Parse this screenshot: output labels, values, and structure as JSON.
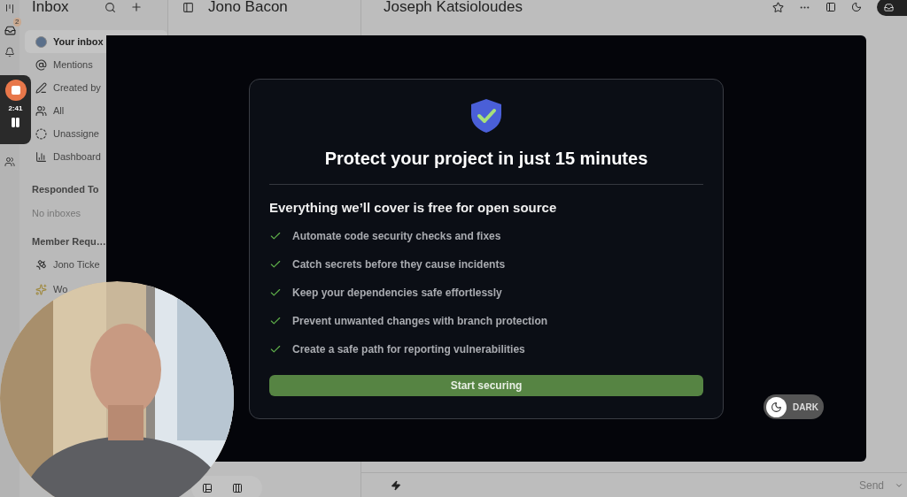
{
  "rail": {
    "badge": "2"
  },
  "recorder": {
    "time": "2:41"
  },
  "sidebar": {
    "title": "Inbox",
    "items": [
      {
        "kind": "avatar",
        "label": "Your inbox",
        "selected": true
      },
      {
        "kind": "at",
        "label": "Mentions",
        "selected": false
      },
      {
        "kind": "pen",
        "label": "Created by",
        "selected": false
      },
      {
        "kind": "users",
        "label": "All",
        "selected": false
      },
      {
        "kind": "unassigned",
        "label": "Unassigne",
        "selected": false
      },
      {
        "kind": "chart",
        "label": "Dashboard",
        "selected": false
      }
    ],
    "sections": [
      {
        "title": "Responded To",
        "items": [
          {
            "kind": "empty",
            "label": "No inboxes"
          }
        ]
      },
      {
        "title": "Member Requ…",
        "items": [
          {
            "kind": "satellite",
            "label": "Jono Ticke"
          },
          {
            "kind": "sparkle",
            "label": "Wo"
          }
        ]
      }
    ]
  },
  "conversation": {
    "title": "Jono Bacon"
  },
  "main": {
    "title": "Joseph Katsioloudes",
    "send": "Send"
  },
  "modal": {
    "title": "Protect your project in just 15 minutes",
    "subtitle": "Everything we’ll cover is free for open source",
    "features": [
      "Automate code security checks and fixes",
      "Catch secrets before they cause incidents",
      "Keep your dependencies safe effortlessly",
      "Prevent unwanted changes with branch protection",
      "Create a safe path for reporting vulnerabilities"
    ],
    "button": "Start securing",
    "theme_toggle": {
      "label": "DARK"
    }
  }
}
